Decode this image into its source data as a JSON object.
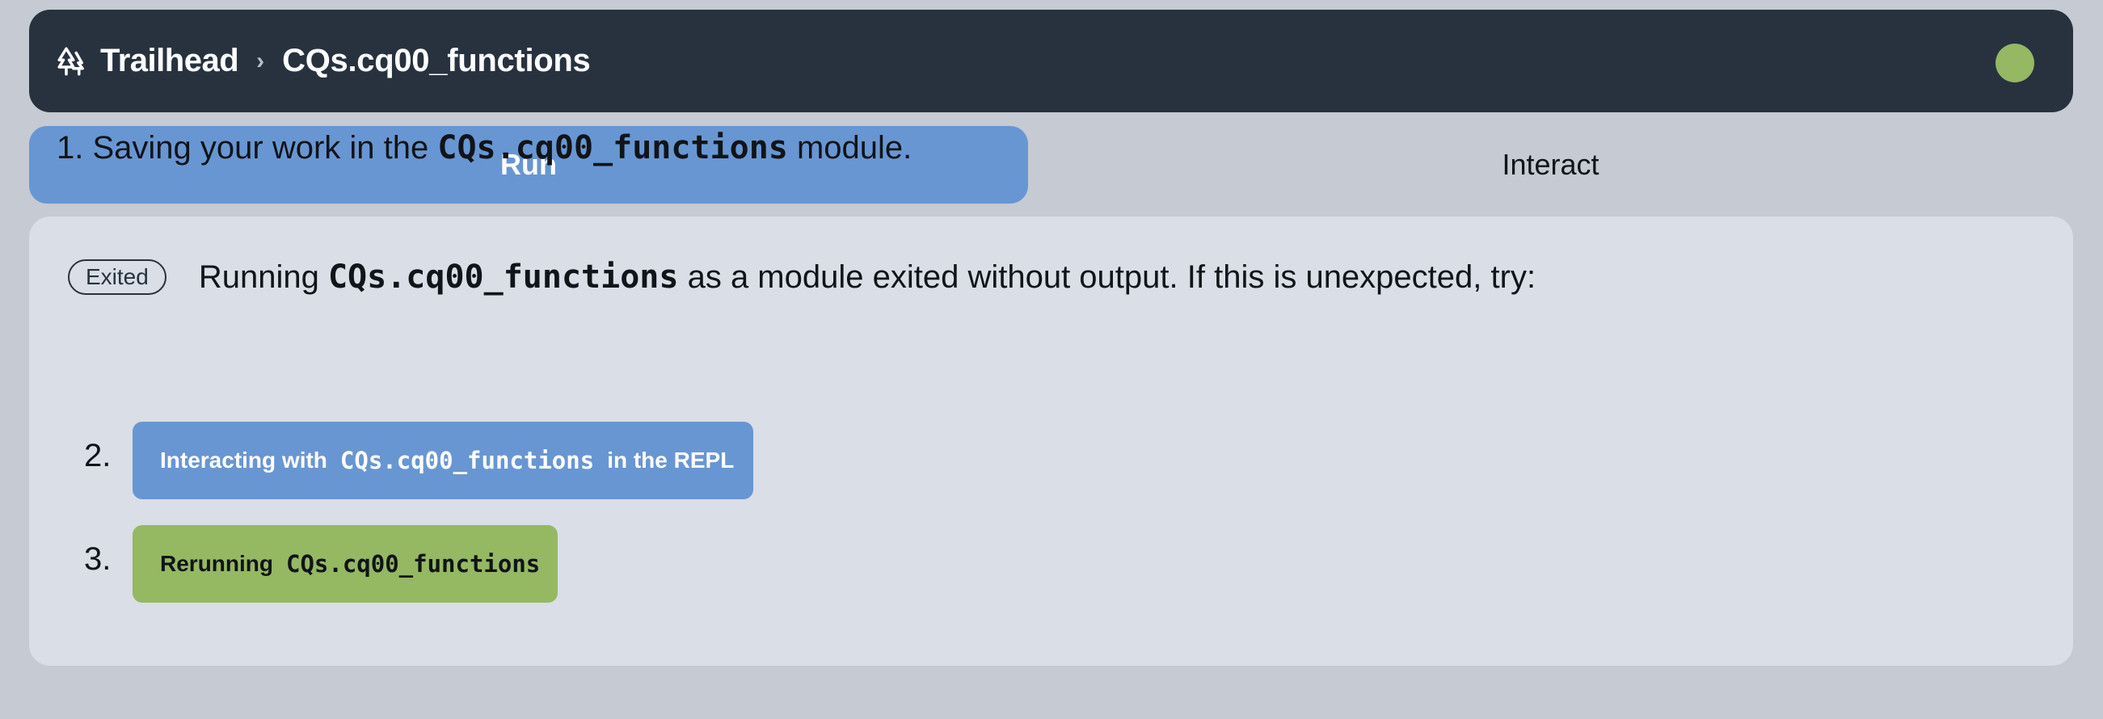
{
  "header": {
    "brand": "Trailhead",
    "breadcrumb_separator": "›",
    "current": "CQs.cq00_functions",
    "brand_icon": "trees-icon",
    "status_color": "#95b863"
  },
  "tabs": [
    {
      "label": "Run",
      "active": true
    },
    {
      "label": "Interact",
      "active": false
    }
  ],
  "panel": {
    "badge": "Exited",
    "message_prefix": "Running",
    "module": "CQs.cq00_functions",
    "message_suffix": "as a module exited without output. If this is unexpected, try:",
    "steps": [
      {
        "number": "1.",
        "prefix": "Saving your work in the",
        "module": "CQs.cq00_functions",
        "suffix": "module."
      },
      {
        "number": "2.",
        "prefix": "Interacting with",
        "module": "CQs.cq00_functions",
        "suffix": "in the REPL"
      },
      {
        "number": "3.",
        "prefix": "Rerunning",
        "module": "CQs.cq00_functions"
      }
    ]
  },
  "colors": {
    "accent_blue": "#6896d2",
    "accent_green": "#95b863",
    "header_bg": "#28323f"
  }
}
